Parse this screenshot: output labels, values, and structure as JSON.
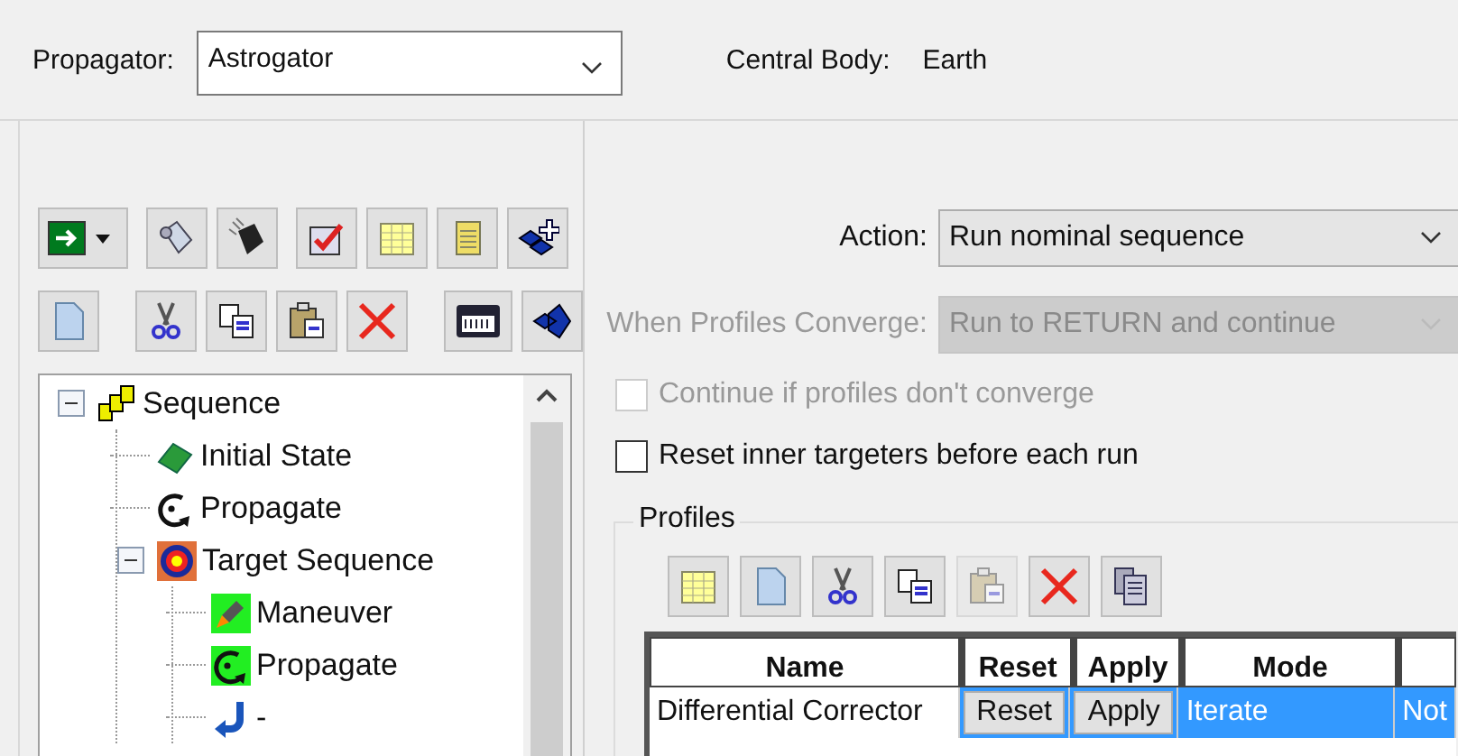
{
  "propagator": {
    "label": "Propagator:",
    "value": "Astrogator"
  },
  "central_body": {
    "label": "Central Body:",
    "value": "Earth"
  },
  "sequence_toolbar": [
    {
      "disabled": false
    },
    {
      "disabled": false
    },
    {
      "disabled": false
    },
    {
      "disabled": false
    },
    {
      "disabled": false
    },
    {
      "disabled": false
    },
    {
      "disabled": false
    },
    {
      "disabled": false
    },
    {
      "disabled": false
    },
    {
      "disabled": false
    },
    {
      "disabled": false
    },
    {
      "disabled": false
    },
    {
      "disabled": false
    },
    {
      "disabled": false
    }
  ],
  "tree": [
    {
      "label": "Sequence",
      "kind": "sequence",
      "expanded": true,
      "children": [
        {
          "label": "Initial State",
          "kind": "initial"
        },
        {
          "label": "Propagate",
          "kind": "propagate"
        },
        {
          "label": "Target Sequence",
          "kind": "target",
          "expanded": true,
          "children": [
            {
              "label": "Maneuver",
              "kind": "maneuver"
            },
            {
              "label": "Propagate",
              "kind": "propagate_green"
            },
            {
              "label": "-",
              "kind": "return"
            }
          ]
        }
      ]
    }
  ],
  "action": {
    "label": "Action:",
    "value": "Run nominal sequence",
    "disabled": false
  },
  "converge": {
    "label": "When Profiles Converge:",
    "value": "Run to RETURN and continue",
    "disabled": true
  },
  "checkboxes": [
    {
      "label": "Continue if profiles don't converge",
      "checked": false,
      "disabled": true
    },
    {
      "label": "Reset inner targeters before each run",
      "checked": false,
      "disabled": false
    }
  ],
  "profiles": {
    "title": "Profiles",
    "toolbar": [
      {
        "disabled": false
      },
      {
        "disabled": false
      },
      {
        "disabled": false
      },
      {
        "disabled": false
      },
      {
        "disabled": true
      },
      {
        "disabled": false
      },
      {
        "disabled": false
      }
    ],
    "columns": [
      "Name",
      "Reset",
      "Apply",
      "Mode"
    ],
    "rows": [
      {
        "name": "Differential Corrector",
        "reset": "Reset",
        "apply": "Apply",
        "mode": "Iterate",
        "column_5": "Not",
        "selected": true
      }
    ]
  }
}
